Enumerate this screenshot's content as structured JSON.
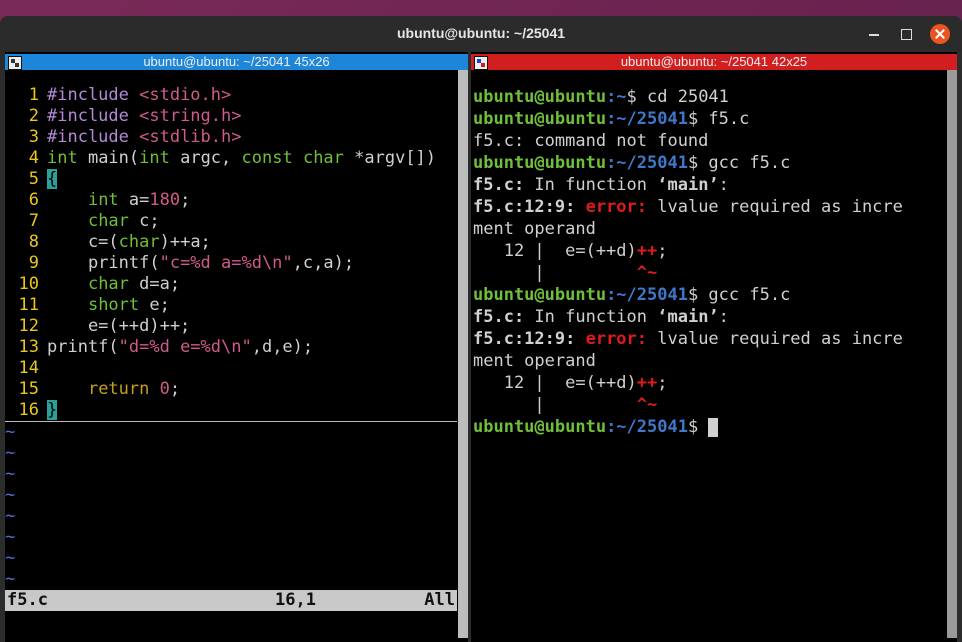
{
  "window": {
    "title": "ubuntu@ubuntu: ~/25041"
  },
  "left_pane": {
    "header": "ubuntu@ubuntu: ~/25041 45x26",
    "lines": [
      {
        "n": "1"
      },
      {
        "n": "2"
      },
      {
        "n": "3"
      },
      {
        "n": "4"
      },
      {
        "n": "5"
      },
      {
        "n": "6"
      },
      {
        "n": "7"
      },
      {
        "n": "8"
      },
      {
        "n": "9"
      },
      {
        "n": "10"
      },
      {
        "n": "11"
      },
      {
        "n": "12"
      },
      {
        "n": "13"
      },
      {
        "n": "14"
      },
      {
        "n": "15"
      },
      {
        "n": "16"
      }
    ],
    "code": {
      "l1a": "#include ",
      "l1b": "<stdio.h>",
      "l2a": "#include ",
      "l2b": "<string.h>",
      "l3a": "#include ",
      "l3b": "<stdlib.h>",
      "l4a": "int",
      "l4b": " main(",
      "l4c": "int",
      "l4d": " argc, ",
      "l4e": "const",
      "l4f": " ",
      "l4g": "char",
      "l4h": " *argv[])",
      "l5": "{",
      "l6a": "    ",
      "l6b": "int",
      "l6c": " a=",
      "l6d": "180",
      "l6e": ";",
      "l7a": "    ",
      "l7b": "char",
      "l7c": " c;",
      "l8a": "    c=(",
      "l8b": "char",
      "l8c": ")++a;",
      "l9a": "    printf(",
      "l9b": "\"c=%d a=%d\\n\"",
      "l9c": ",c,a);",
      "l10a": "    ",
      "l10b": "char",
      "l10c": " d=a;",
      "l11a": "    ",
      "l11b": "short",
      "l11c": " e;",
      "l12": "    e=(++d)++;",
      "l13a": "printf(",
      "l13b": "\"d=%d e=%d\\n\"",
      "l13c": ",d,e);",
      "l14": "",
      "l15a": "    ",
      "l15b": "return",
      "l15c": " ",
      "l15d": "0",
      "l15e": ";",
      "l16": "}"
    },
    "tilde": "~",
    "status": {
      "filename": "f5.c",
      "position": "16,1",
      "scroll": "All"
    }
  },
  "right_pane": {
    "header": "ubuntu@ubuntu: ~/25041 42x25",
    "user": "ubuntu@ubuntu",
    "path_home": ":~",
    "path_dir": ":~/25041",
    "t1": "$ cd 25041",
    "t2": "$ f5.c",
    "t3": "f5.c: command not found",
    "t4": "$ gcc f5.c",
    "fn_file": "f5.c:",
    "fn_text": " In function ",
    "fn_name": "‘main’",
    "fn_colon": ":",
    "err_loc": "f5.c:12:9:",
    "err_word": " error:",
    "err_msg": " lvalue required as incre",
    "err_msg2": "ment operand",
    "src_line": "   12 |  e=(++d)",
    "src_pp": "++",
    "src_semi": ";",
    "caret_bar": "      |         ",
    "caret": "^~",
    "t_last": "$ "
  },
  "colors": {
    "accent": "#e95420",
    "left_header": "#1e86d9",
    "right_header": "#d11f1f",
    "linenr": "#e7c81b"
  }
}
